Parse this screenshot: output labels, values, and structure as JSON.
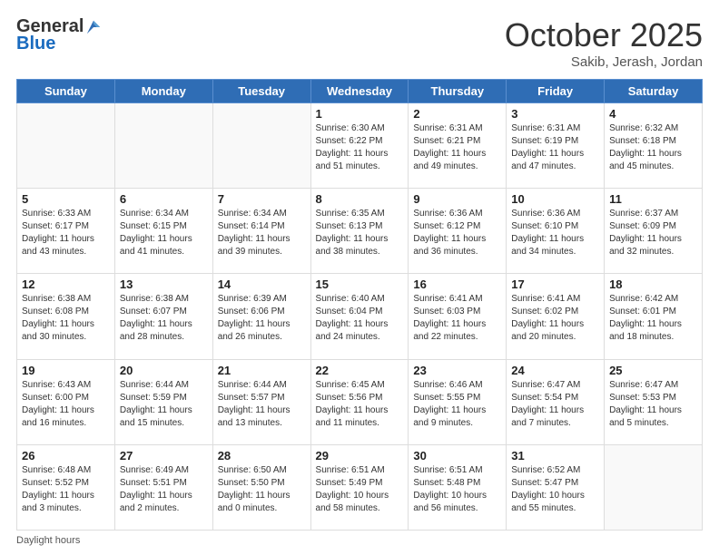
{
  "logo": {
    "general": "General",
    "blue": "Blue"
  },
  "header": {
    "month_year": "October 2025",
    "location": "Sakib, Jerash, Jordan"
  },
  "days_of_week": [
    "Sunday",
    "Monday",
    "Tuesday",
    "Wednesday",
    "Thursday",
    "Friday",
    "Saturday"
  ],
  "weeks": [
    [
      {
        "num": "",
        "info": ""
      },
      {
        "num": "",
        "info": ""
      },
      {
        "num": "",
        "info": ""
      },
      {
        "num": "1",
        "info": "Sunrise: 6:30 AM\nSunset: 6:22 PM\nDaylight: 11 hours\nand 51 minutes."
      },
      {
        "num": "2",
        "info": "Sunrise: 6:31 AM\nSunset: 6:21 PM\nDaylight: 11 hours\nand 49 minutes."
      },
      {
        "num": "3",
        "info": "Sunrise: 6:31 AM\nSunset: 6:19 PM\nDaylight: 11 hours\nand 47 minutes."
      },
      {
        "num": "4",
        "info": "Sunrise: 6:32 AM\nSunset: 6:18 PM\nDaylight: 11 hours\nand 45 minutes."
      }
    ],
    [
      {
        "num": "5",
        "info": "Sunrise: 6:33 AM\nSunset: 6:17 PM\nDaylight: 11 hours\nand 43 minutes."
      },
      {
        "num": "6",
        "info": "Sunrise: 6:34 AM\nSunset: 6:15 PM\nDaylight: 11 hours\nand 41 minutes."
      },
      {
        "num": "7",
        "info": "Sunrise: 6:34 AM\nSunset: 6:14 PM\nDaylight: 11 hours\nand 39 minutes."
      },
      {
        "num": "8",
        "info": "Sunrise: 6:35 AM\nSunset: 6:13 PM\nDaylight: 11 hours\nand 38 minutes."
      },
      {
        "num": "9",
        "info": "Sunrise: 6:36 AM\nSunset: 6:12 PM\nDaylight: 11 hours\nand 36 minutes."
      },
      {
        "num": "10",
        "info": "Sunrise: 6:36 AM\nSunset: 6:10 PM\nDaylight: 11 hours\nand 34 minutes."
      },
      {
        "num": "11",
        "info": "Sunrise: 6:37 AM\nSunset: 6:09 PM\nDaylight: 11 hours\nand 32 minutes."
      }
    ],
    [
      {
        "num": "12",
        "info": "Sunrise: 6:38 AM\nSunset: 6:08 PM\nDaylight: 11 hours\nand 30 minutes."
      },
      {
        "num": "13",
        "info": "Sunrise: 6:38 AM\nSunset: 6:07 PM\nDaylight: 11 hours\nand 28 minutes."
      },
      {
        "num": "14",
        "info": "Sunrise: 6:39 AM\nSunset: 6:06 PM\nDaylight: 11 hours\nand 26 minutes."
      },
      {
        "num": "15",
        "info": "Sunrise: 6:40 AM\nSunset: 6:04 PM\nDaylight: 11 hours\nand 24 minutes."
      },
      {
        "num": "16",
        "info": "Sunrise: 6:41 AM\nSunset: 6:03 PM\nDaylight: 11 hours\nand 22 minutes."
      },
      {
        "num": "17",
        "info": "Sunrise: 6:41 AM\nSunset: 6:02 PM\nDaylight: 11 hours\nand 20 minutes."
      },
      {
        "num": "18",
        "info": "Sunrise: 6:42 AM\nSunset: 6:01 PM\nDaylight: 11 hours\nand 18 minutes."
      }
    ],
    [
      {
        "num": "19",
        "info": "Sunrise: 6:43 AM\nSunset: 6:00 PM\nDaylight: 11 hours\nand 16 minutes."
      },
      {
        "num": "20",
        "info": "Sunrise: 6:44 AM\nSunset: 5:59 PM\nDaylight: 11 hours\nand 15 minutes."
      },
      {
        "num": "21",
        "info": "Sunrise: 6:44 AM\nSunset: 5:57 PM\nDaylight: 11 hours\nand 13 minutes."
      },
      {
        "num": "22",
        "info": "Sunrise: 6:45 AM\nSunset: 5:56 PM\nDaylight: 11 hours\nand 11 minutes."
      },
      {
        "num": "23",
        "info": "Sunrise: 6:46 AM\nSunset: 5:55 PM\nDaylight: 11 hours\nand 9 minutes."
      },
      {
        "num": "24",
        "info": "Sunrise: 6:47 AM\nSunset: 5:54 PM\nDaylight: 11 hours\nand 7 minutes."
      },
      {
        "num": "25",
        "info": "Sunrise: 6:47 AM\nSunset: 5:53 PM\nDaylight: 11 hours\nand 5 minutes."
      }
    ],
    [
      {
        "num": "26",
        "info": "Sunrise: 6:48 AM\nSunset: 5:52 PM\nDaylight: 11 hours\nand 3 minutes."
      },
      {
        "num": "27",
        "info": "Sunrise: 6:49 AM\nSunset: 5:51 PM\nDaylight: 11 hours\nand 2 minutes."
      },
      {
        "num": "28",
        "info": "Sunrise: 6:50 AM\nSunset: 5:50 PM\nDaylight: 11 hours\nand 0 minutes."
      },
      {
        "num": "29",
        "info": "Sunrise: 6:51 AM\nSunset: 5:49 PM\nDaylight: 10 hours\nand 58 minutes."
      },
      {
        "num": "30",
        "info": "Sunrise: 6:51 AM\nSunset: 5:48 PM\nDaylight: 10 hours\nand 56 minutes."
      },
      {
        "num": "31",
        "info": "Sunrise: 6:52 AM\nSunset: 5:47 PM\nDaylight: 10 hours\nand 55 minutes."
      },
      {
        "num": "",
        "info": ""
      }
    ]
  ],
  "footer": {
    "note": "Daylight hours"
  }
}
